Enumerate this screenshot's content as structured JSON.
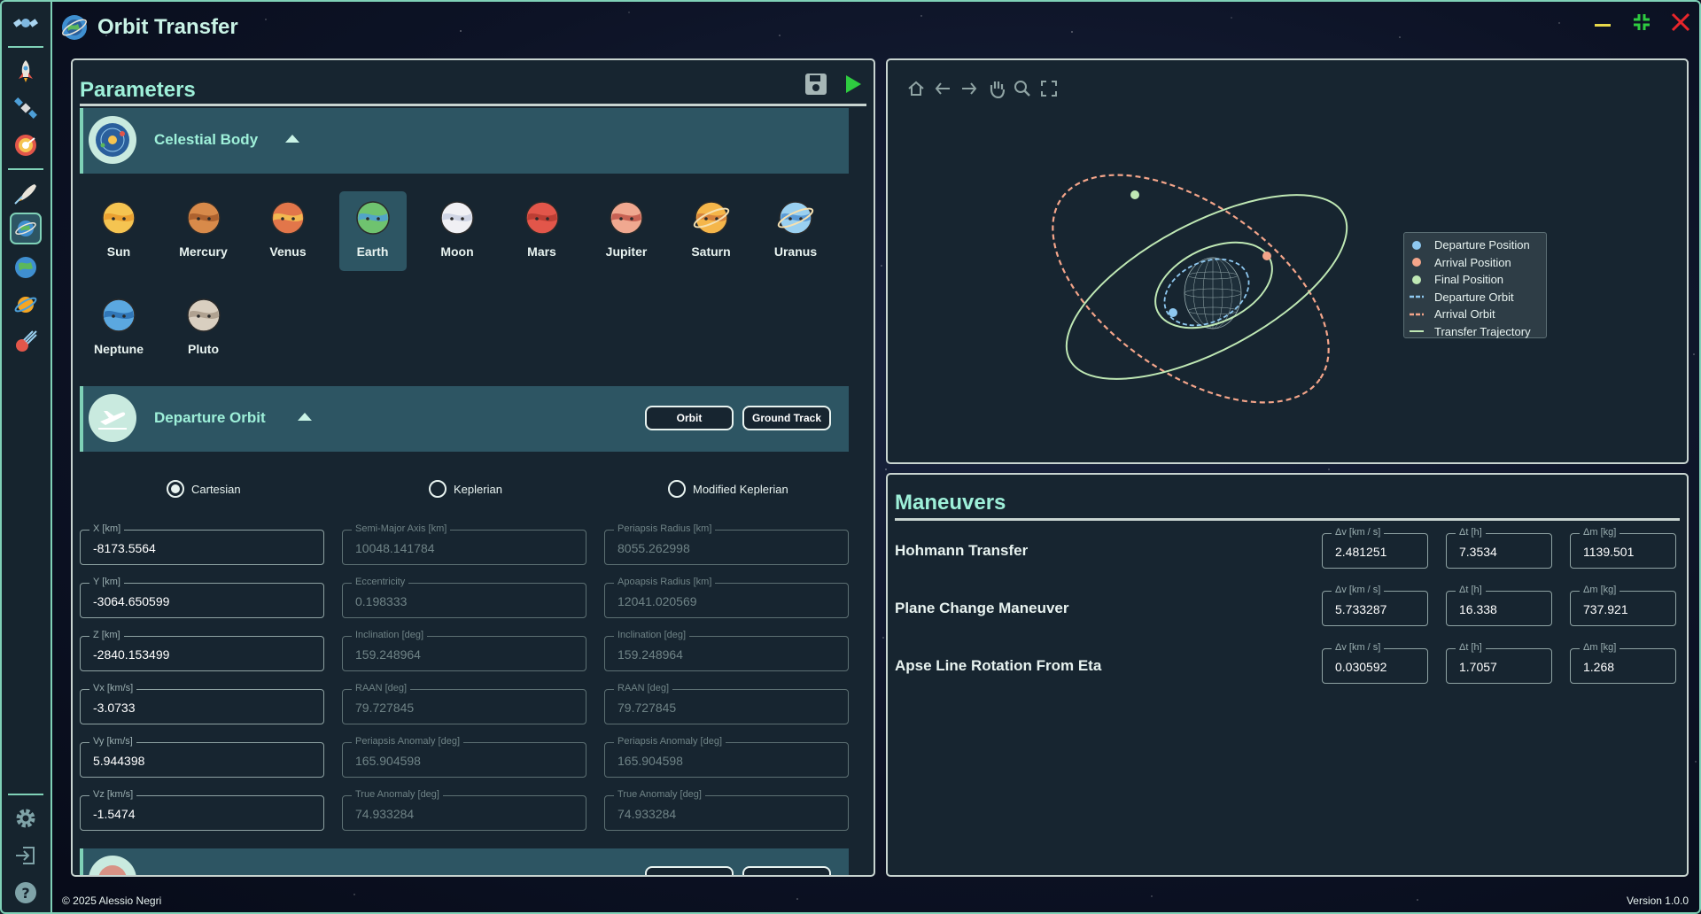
{
  "app": {
    "title": "Orbit Transfer"
  },
  "sidebar": {
    "items": [
      {
        "icon": "satellite-logo-icon"
      },
      {
        "icon": "rocket-icon"
      },
      {
        "icon": "satellite-icon"
      },
      {
        "icon": "radar-icon"
      },
      {
        "icon": "launch-icon"
      },
      {
        "icon": "orbit-transfer-icon",
        "active": true
      },
      {
        "icon": "earth-icon"
      },
      {
        "icon": "planet-orbit-icon"
      },
      {
        "icon": "comet-icon"
      }
    ],
    "bottom": [
      {
        "icon": "gear-icon"
      },
      {
        "icon": "logout-icon"
      },
      {
        "icon": "help-icon"
      }
    ]
  },
  "parameters": {
    "title": "Parameters",
    "celestial_body": {
      "title": "Celestial Body",
      "bodies": [
        "Sun",
        "Mercury",
        "Venus",
        "Earth",
        "Moon",
        "Mars",
        "Jupiter",
        "Saturn",
        "Uranus",
        "Neptune",
        "Pluto"
      ],
      "selected": "Earth"
    },
    "departure_orbit": {
      "title": "Departure Orbit",
      "buttons": {
        "orbit": "Orbit",
        "ground_track": "Ground Track"
      },
      "modes": [
        "Cartesian",
        "Keplerian",
        "Modified Keplerian"
      ],
      "selected_mode": "Cartesian",
      "cartesian": [
        {
          "label": "X [km]",
          "value": "-8173.5564"
        },
        {
          "label": "Y [km]",
          "value": "-3064.650599"
        },
        {
          "label": "Z [km]",
          "value": "-2840.153499"
        },
        {
          "label": "Vx [km/s]",
          "value": "-3.0733"
        },
        {
          "label": "Vy [km/s]",
          "value": "5.944398"
        },
        {
          "label": "Vz [km/s]",
          "value": "-1.5474"
        }
      ],
      "keplerian": [
        {
          "label": "Semi-Major Axis [km]",
          "value": "10048.141784"
        },
        {
          "label": "Eccentricity",
          "value": "0.198333"
        },
        {
          "label": "Inclination [deg]",
          "value": "159.248964"
        },
        {
          "label": "RAAN [deg]",
          "value": "79.727845"
        },
        {
          "label": "Periapsis Anomaly [deg]",
          "value": "165.904598"
        },
        {
          "label": "True Anomaly [deg]",
          "value": "74.933284"
        }
      ],
      "modified_keplerian": [
        {
          "label": "Periapsis Radius [km]",
          "value": "8055.262998"
        },
        {
          "label": "Apoapsis Radius [km]",
          "value": "12041.020569"
        },
        {
          "label": "Inclination [deg]",
          "value": "159.248964"
        },
        {
          "label": "RAAN [deg]",
          "value": "79.727845"
        },
        {
          "label": "Periapsis Anomaly [deg]",
          "value": "165.904598"
        },
        {
          "label": "True Anomaly [deg]",
          "value": "74.933284"
        }
      ]
    }
  },
  "plot": {
    "toolbar": [
      "home-icon",
      "back-arrow-icon",
      "forward-arrow-icon",
      "pan-hand-icon",
      "zoom-icon",
      "fullscreen-icon"
    ],
    "legend": [
      {
        "label": "Departure Position",
        "kind": "dot",
        "color": "#8ec8f0"
      },
      {
        "label": "Arrival Position",
        "kind": "dot",
        "color": "#f4a58a"
      },
      {
        "label": "Final Position",
        "kind": "dot",
        "color": "#bfe8b4"
      },
      {
        "label": "Departure Orbit",
        "kind": "dashed",
        "color": "#8ec8f0"
      },
      {
        "label": "Arrival Orbit",
        "kind": "dashed",
        "color": "#f4a58a"
      },
      {
        "label": "Transfer Trajectory",
        "kind": "solid",
        "color": "#bfe8b4"
      }
    ]
  },
  "maneuvers": {
    "title": "Maneuvers",
    "labels": {
      "dv": "Δv [km / s]",
      "dt": "Δt [h]",
      "dm": "Δm [kg]"
    },
    "rows": [
      {
        "name": "Hohmann Transfer",
        "dv": "2.481251",
        "dt": "7.3534",
        "dm": "1139.501"
      },
      {
        "name": "Plane Change Maneuver",
        "dv": "5.733287",
        "dt": "16.338",
        "dm": "737.921"
      },
      {
        "name": "Apse Line Rotation From Eta",
        "dv": "0.030592",
        "dt": "1.7057",
        "dm": "1.268"
      }
    ]
  },
  "footer": {
    "copyright": "© 2025 Alessio Negri",
    "version": "Version 1.0.0"
  }
}
